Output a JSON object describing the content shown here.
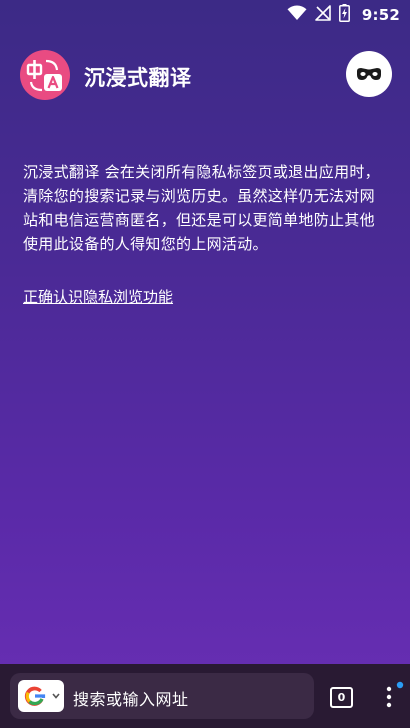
{
  "status_bar": {
    "time": "9:52",
    "wifi_icon": "wifi-icon",
    "signal_icon": "no-signal-icon",
    "battery_icon": "battery-charging-icon"
  },
  "header": {
    "app_title": "沉浸式翻译",
    "logo_icon": "translate-logo-icon",
    "incognito_icon": "incognito-mask-icon",
    "logo_color": "#e94b82"
  },
  "content": {
    "description": "沉浸式翻译 会在关闭所有隐私标签页或退出应用时，清除您的搜索记录与浏览历史。虽然这样仍无法对网站和电信运营商匿名，但还是可以更简单地防止其他使用此设备的人得知您的上网活动。",
    "learn_more_link": "正确认识隐私浏览功能"
  },
  "bottom_bar": {
    "search_placeholder": "搜索或输入网址",
    "search_engine_icon": "google-g-icon",
    "tab_count": "0",
    "menu_icon": "more-vertical-icon",
    "notification_dot_color": "#2a9df4"
  },
  "colors": {
    "background_top": "#3c2a86",
    "background_bottom": "#6a2fb5",
    "bottom_bar": "#291a33"
  }
}
